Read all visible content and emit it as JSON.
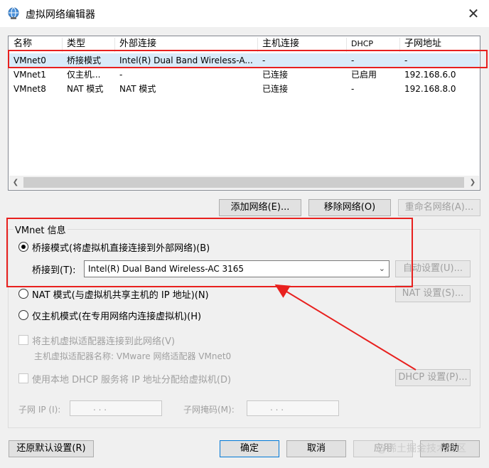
{
  "window": {
    "title": "虚拟网络编辑器",
    "close_glyph": "✕"
  },
  "list": {
    "headers": [
      "名称",
      "类型",
      "外部连接",
      "主机连接",
      "DHCP",
      "子网地址"
    ],
    "rows": [
      [
        "VMnet0",
        "桥接模式",
        "Intel(R) Dual Band Wireless-A...",
        "-",
        "-",
        "-"
      ],
      [
        "VMnet1",
        "仅主机...",
        "-",
        "已连接",
        "已启用",
        "192.168.6.0"
      ],
      [
        "VMnet8",
        "NAT 模式",
        "NAT 模式",
        "已连接",
        "-",
        "192.168.8.0"
      ]
    ],
    "selected_row": 0
  },
  "list_buttons": {
    "add": "添加网络(E)...",
    "remove": "移除网络(O)",
    "rename": "重命名网络(A)..."
  },
  "vmnet_info": {
    "group_label": "VMnet 信息",
    "bridged_label": "桥接模式(将虚拟机直接连接到外部网络)(B)",
    "bridged_to_label": "桥接到(T):",
    "bridged_to_value": "Intel(R) Dual Band Wireless-AC 3165",
    "auto_settings": "自动设置(U)...",
    "nat_label": "NAT 模式(与虚拟机共享主机的 IP 地址)(N)",
    "nat_settings": "NAT 设置(S)...",
    "hostonly_label": "仅主机模式(在专用网络内连接虚拟机)(H)",
    "connect_adapter_label": "将主机虚拟适配器连接到此网络(V)",
    "adapter_name_label": "主机虚拟适配器名称: VMware 网络适配器 VMnet0",
    "dhcp_label": "使用本地 DHCP 服务将 IP 地址分配给虚拟机(D)",
    "dhcp_settings": "DHCP 设置(P)...",
    "subnet_ip_label": "子网 IP (I):",
    "subnet_ip_value": " .  .  . ",
    "subnet_mask_label": "子网掩码(M):",
    "subnet_mask_value": " .  .  . "
  },
  "footer": {
    "restore": "还原默认设置(R)",
    "ok": "确定",
    "cancel": "取消",
    "apply": "应用",
    "help": "帮助"
  },
  "watermark": "@稀土掘金技术社区",
  "colors": {
    "annotation": "#e8201e",
    "selection": "#d9ebf9"
  }
}
